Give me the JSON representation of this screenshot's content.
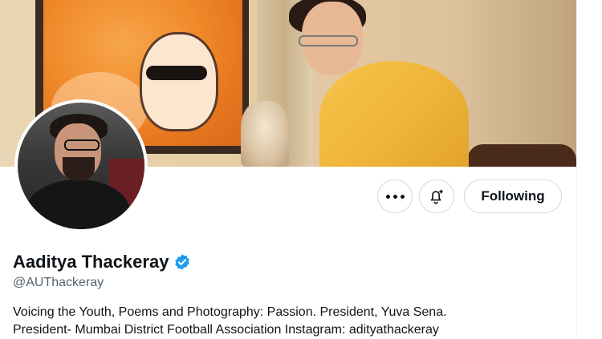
{
  "profile": {
    "display_name": "Aaditya Thackeray",
    "handle": "@AUThackeray",
    "bio_lines": [
      "Voicing the Youth, Poems and Photography: Passion. President, Yuva Sena.",
      "President- Mumbai District Football Association Instagram: adityathackeray"
    ],
    "verified": true
  },
  "actions": {
    "more_icon": "more-horizontal-icon",
    "notify_icon": "bell-plus-icon",
    "follow_label": "Following"
  },
  "colors": {
    "verified_badge": "#1d9bf0",
    "text_primary": "#0f1419",
    "text_secondary": "#536471",
    "button_border": "#cfd9de"
  }
}
